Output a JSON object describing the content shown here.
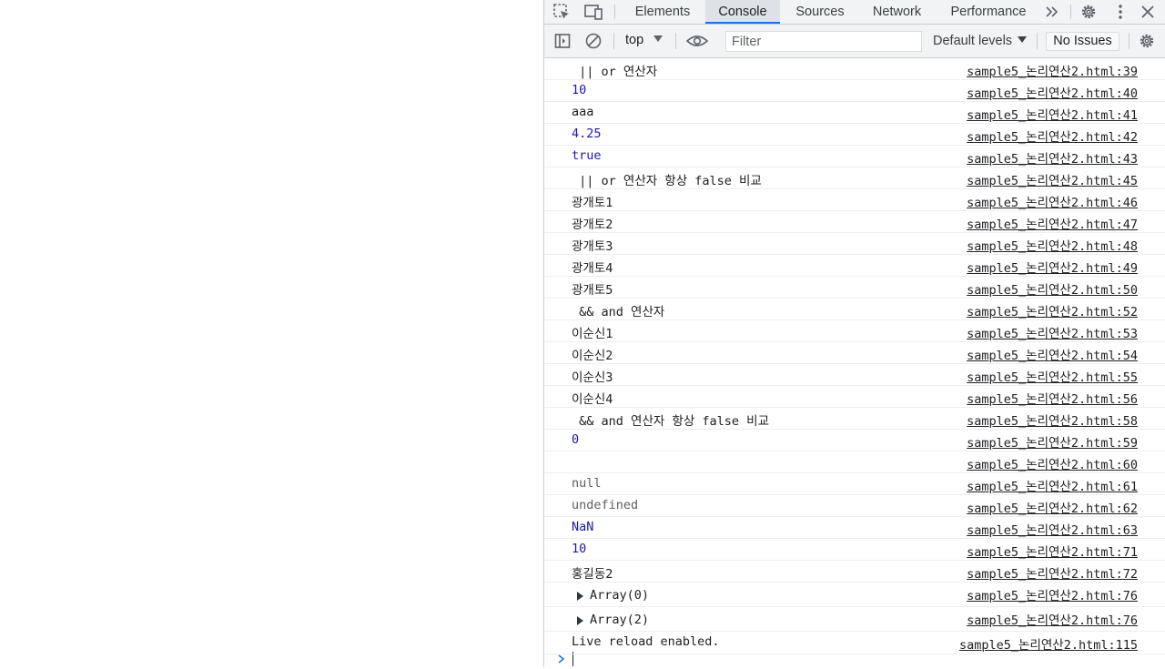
{
  "devtools": {
    "tabs": [
      "Elements",
      "Console",
      "Sources",
      "Network",
      "Performance"
    ],
    "active_tab": "Console",
    "toolbar": {
      "context": "top",
      "filter_placeholder": "Filter",
      "levels_label": "Default levels",
      "issues_label": "No Issues"
    },
    "console_rows": [
      {
        "text": " || or 연산자",
        "type": "string",
        "source": "sample5_논리연산2.html:39"
      },
      {
        "text": "10",
        "type": "number",
        "source": "sample5_논리연산2.html:40"
      },
      {
        "text": "aaa",
        "type": "string",
        "source": "sample5_논리연산2.html:41"
      },
      {
        "text": "4.25",
        "type": "number",
        "source": "sample5_논리연산2.html:42"
      },
      {
        "text": "true",
        "type": "number",
        "source": "sample5_논리연산2.html:43"
      },
      {
        "text": " || or 연산자 항상 false 비교",
        "type": "string",
        "source": "sample5_논리연산2.html:45"
      },
      {
        "text": "광개토1",
        "type": "string",
        "source": "sample5_논리연산2.html:46"
      },
      {
        "text": "광개토2",
        "type": "string",
        "source": "sample5_논리연산2.html:47"
      },
      {
        "text": "광개토3",
        "type": "string",
        "source": "sample5_논리연산2.html:48"
      },
      {
        "text": "광개토4",
        "type": "string",
        "source": "sample5_논리연산2.html:49"
      },
      {
        "text": "광개토5",
        "type": "string",
        "source": "sample5_논리연산2.html:50"
      },
      {
        "text": " && and 연산자",
        "type": "string",
        "source": "sample5_논리연산2.html:52"
      },
      {
        "text": "이순신1",
        "type": "string",
        "source": "sample5_논리연산2.html:53"
      },
      {
        "text": "이순신2",
        "type": "string",
        "source": "sample5_논리연산2.html:54"
      },
      {
        "text": "이순신3",
        "type": "string",
        "source": "sample5_논리연산2.html:55"
      },
      {
        "text": "이순신4",
        "type": "string",
        "source": "sample5_논리연산2.html:56"
      },
      {
        "text": " && and 연산자 항상 false 비교",
        "type": "string",
        "source": "sample5_논리연산2.html:58"
      },
      {
        "text": "0",
        "type": "number",
        "source": "sample5_논리연산2.html:59"
      },
      {
        "text": "",
        "type": "string",
        "source": "sample5_논리연산2.html:60"
      },
      {
        "text": "null",
        "type": "null",
        "source": "sample5_논리연산2.html:61"
      },
      {
        "text": "undefined",
        "type": "null",
        "source": "sample5_논리연산2.html:62"
      },
      {
        "text": "NaN",
        "type": "number",
        "source": "sample5_논리연산2.html:63"
      },
      {
        "text": "10",
        "type": "number",
        "source": "sample5_논리연산2.html:71"
      },
      {
        "text": "홍길동2",
        "type": "string",
        "source": "sample5_논리연산2.html:72"
      },
      {
        "text": "Array(0)",
        "type": "object",
        "source": "sample5_논리연산2.html:76"
      },
      {
        "text": "Array(2)",
        "type": "object",
        "source": "sample5_논리연산2.html:76"
      },
      {
        "text": "Live reload enabled.",
        "type": "string",
        "source": "sample5_논리연산2.html:115"
      }
    ],
    "prompt_symbol": "›",
    "colors": {
      "accent": "#1a73e8",
      "number": "#1a1aa6",
      "null": "#5e5e5e"
    }
  }
}
